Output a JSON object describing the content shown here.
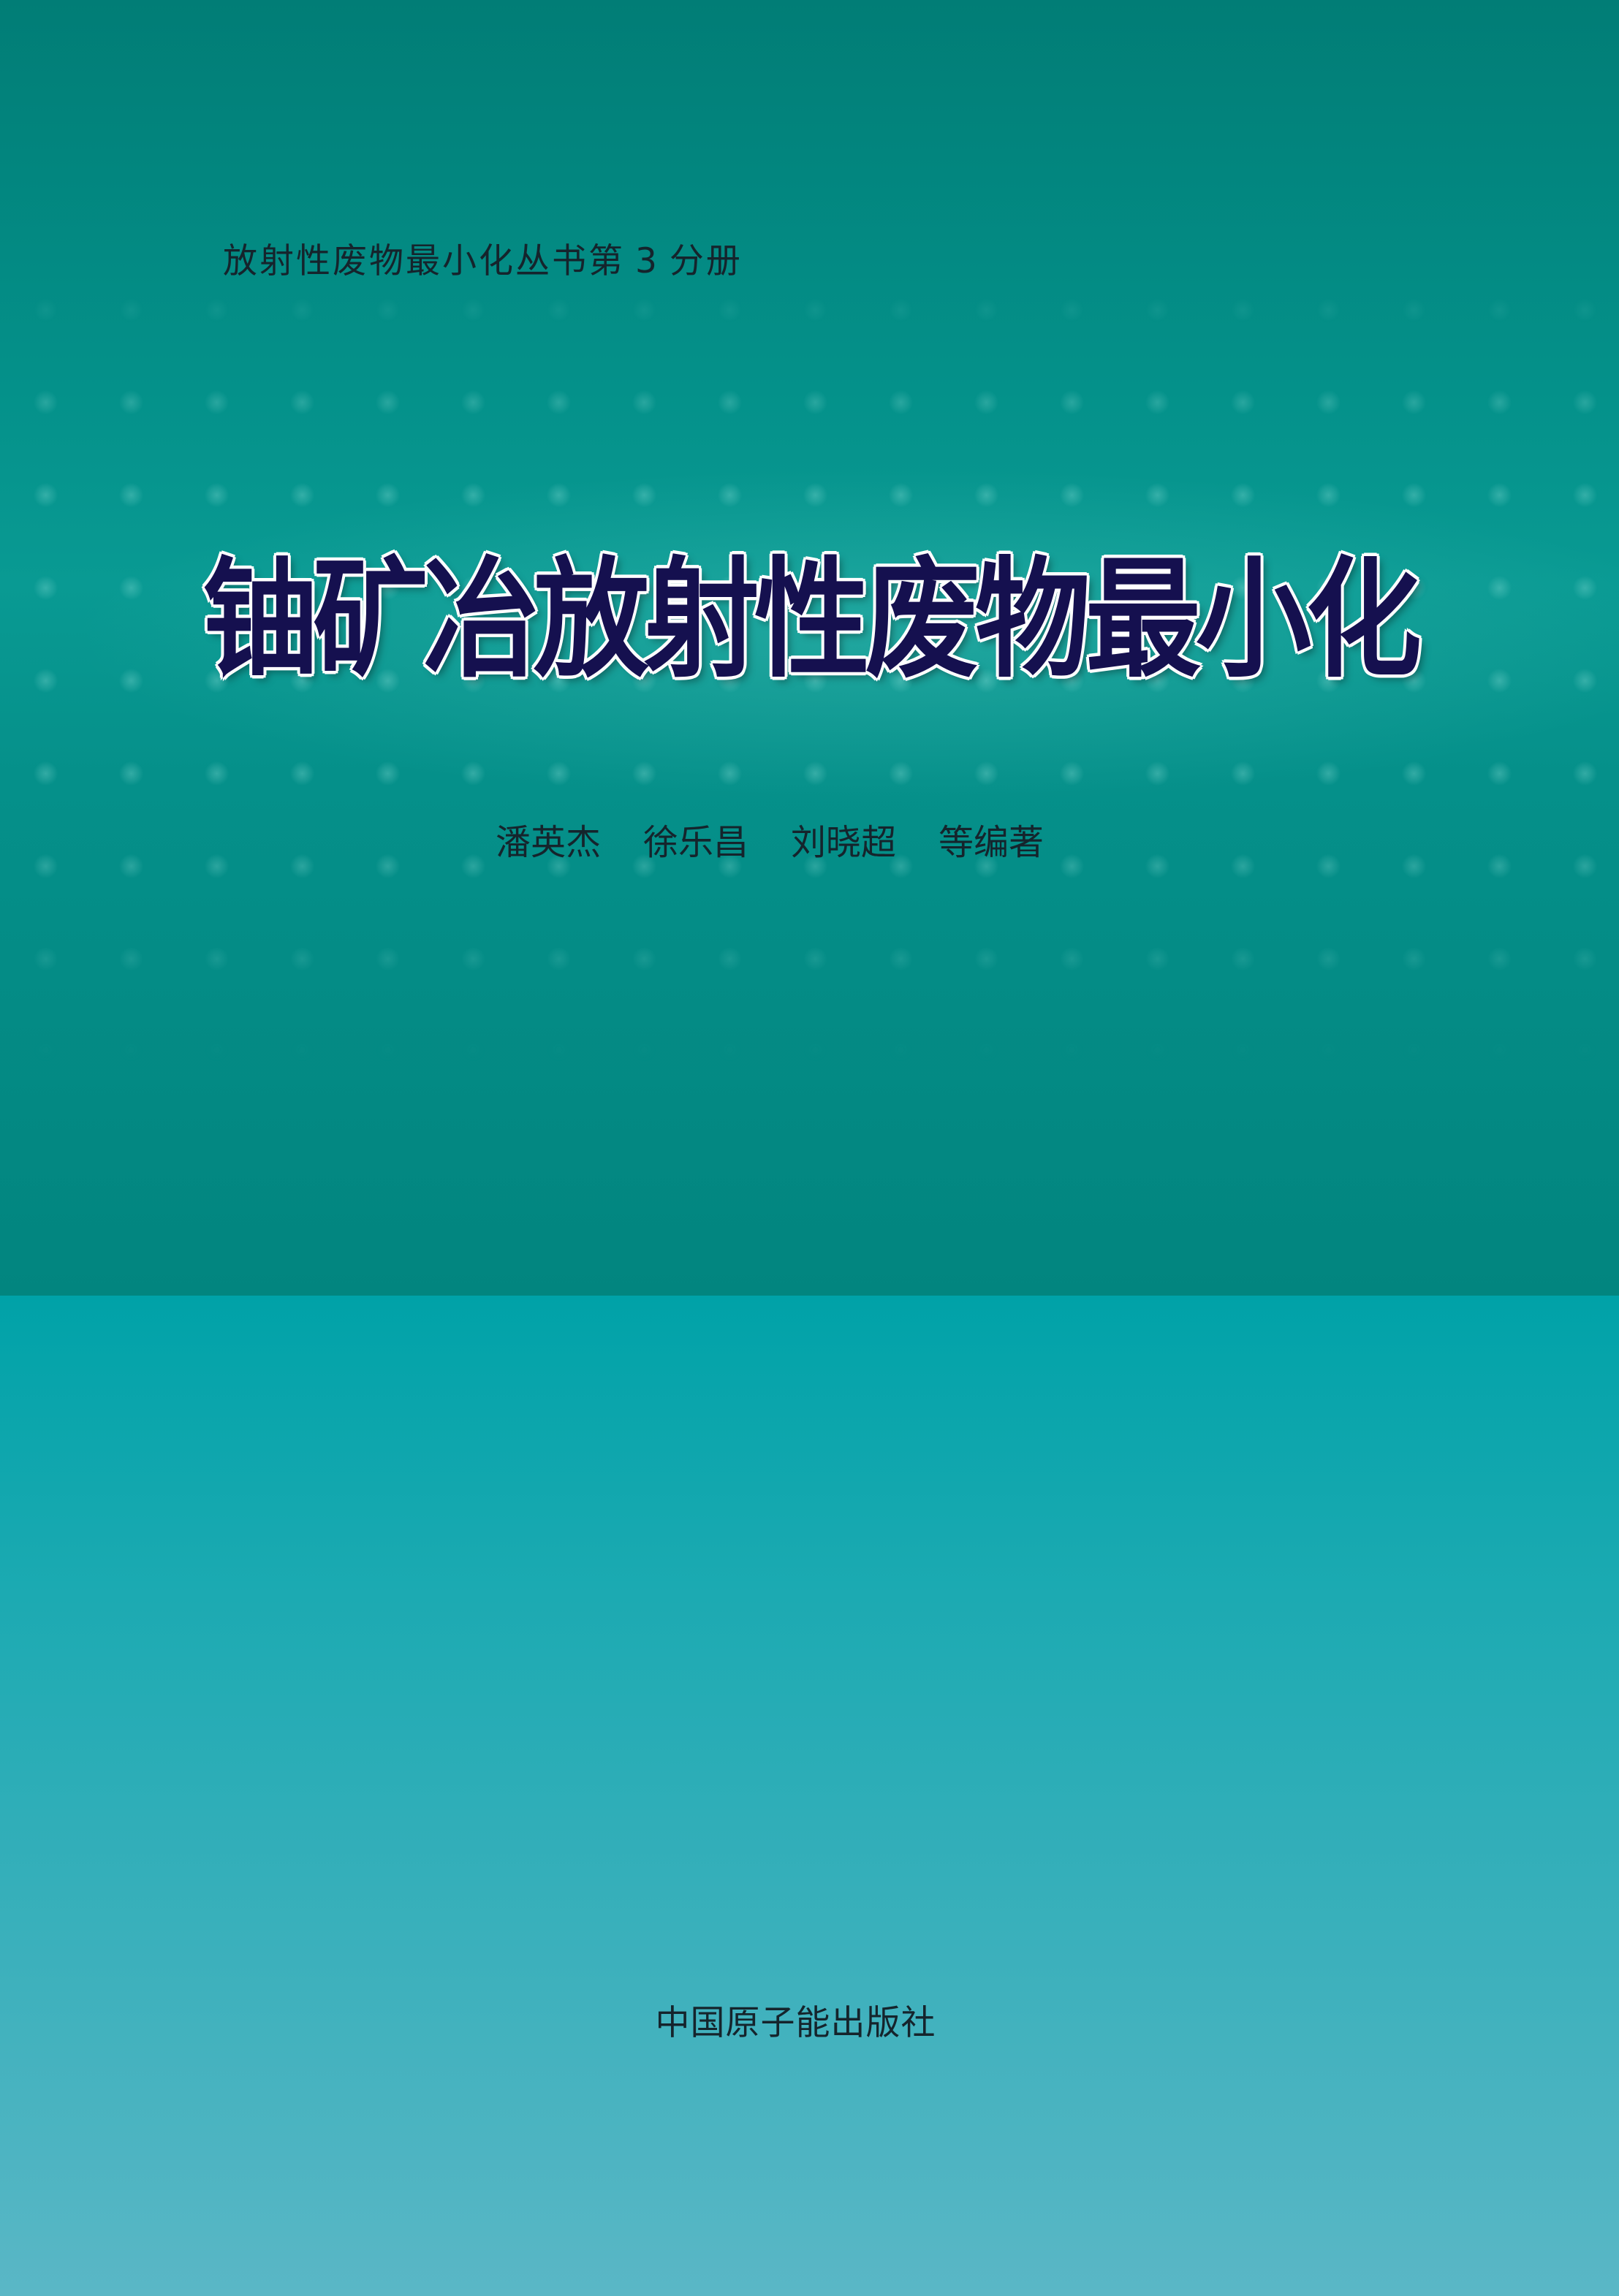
{
  "cover": {
    "series": {
      "prefix": "放射性废物最小化丛书第",
      "volume": "3",
      "suffix": "分册"
    },
    "title": "铀矿冶放射性废物最小化",
    "authors": [
      "潘英杰",
      "徐乐昌",
      "刘晓超",
      "等编著"
    ],
    "publisher": "中国原子能出版社"
  },
  "colors": {
    "top_band": "#04918a",
    "bottom_band": "#1caab2",
    "title_fill": "#15104f",
    "title_outline": "#ffffff",
    "body_text": "#15242c"
  }
}
